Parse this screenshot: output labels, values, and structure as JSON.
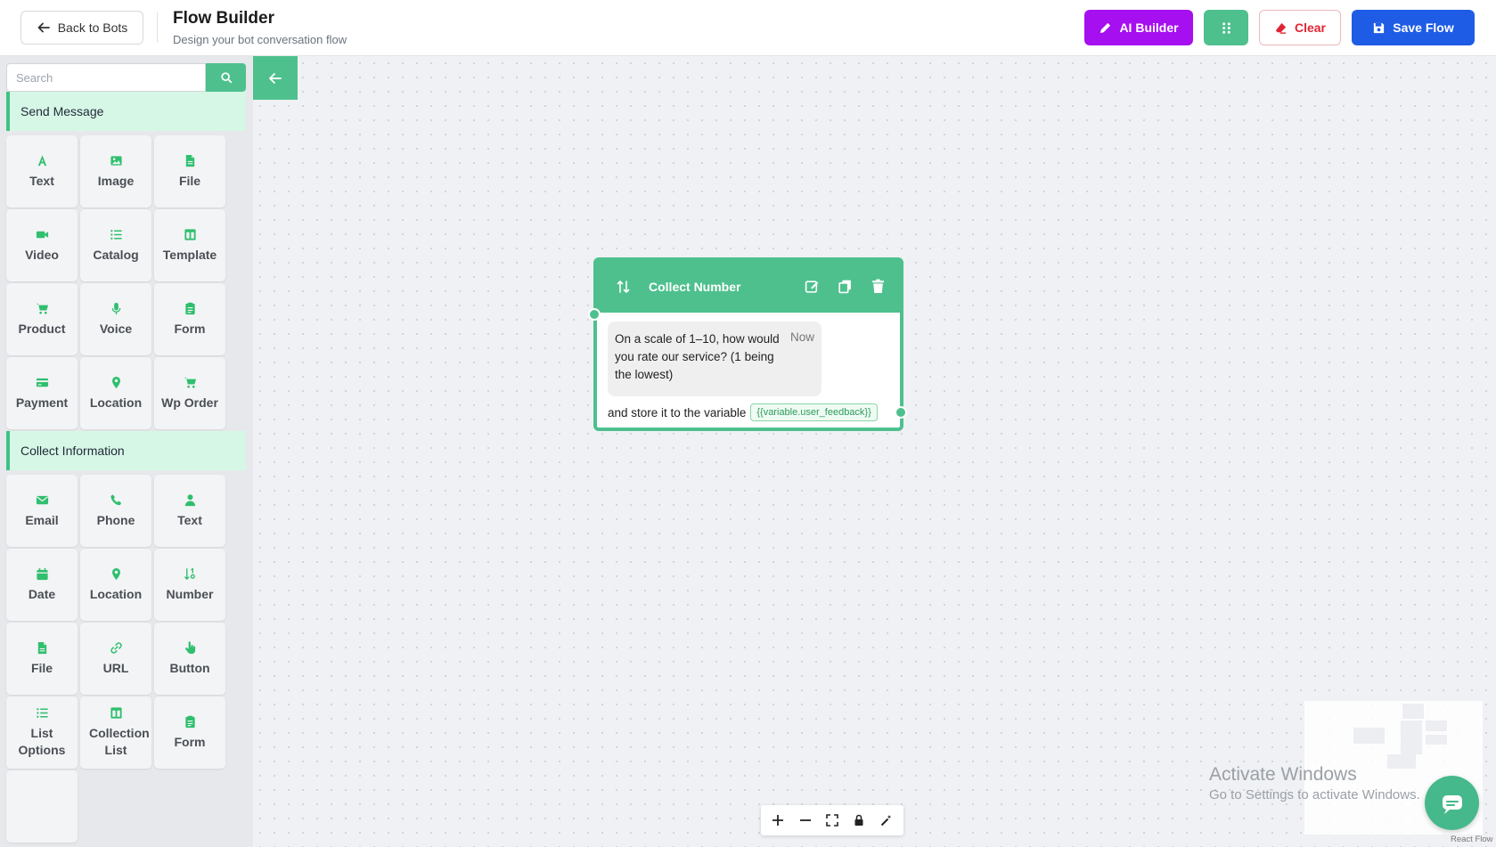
{
  "header": {
    "back_label": "Back to Bots",
    "title": "Flow Builder",
    "subtitle": "Design your bot conversation flow",
    "ai_builder_label": "AI Builder",
    "clear_label": "Clear",
    "save_label": "Save Flow"
  },
  "sidebar": {
    "search_placeholder": "Search",
    "sections": [
      {
        "title": "Send Message",
        "items": [
          {
            "label": "Text",
            "icon": "font-icon"
          },
          {
            "label": "Image",
            "icon": "image-icon"
          },
          {
            "label": "File",
            "icon": "file-icon"
          },
          {
            "label": "Video",
            "icon": "video-icon"
          },
          {
            "label": "Catalog",
            "icon": "list-icon"
          },
          {
            "label": "Template",
            "icon": "template-icon"
          },
          {
            "label": "Product",
            "icon": "cart-icon"
          },
          {
            "label": "Voice",
            "icon": "microphone-icon"
          },
          {
            "label": "Form",
            "icon": "form-icon"
          },
          {
            "label": "Payment",
            "icon": "credit-card-icon"
          },
          {
            "label": "Location",
            "icon": "location-pin-icon"
          },
          {
            "label": "Wp Order",
            "icon": "cart-icon"
          }
        ]
      },
      {
        "title": "Collect Information",
        "items": [
          {
            "label": "Email",
            "icon": "envelope-icon"
          },
          {
            "label": "Phone",
            "icon": "phone-icon"
          },
          {
            "label": "Text",
            "icon": "user-icon"
          },
          {
            "label": "Date",
            "icon": "calendar-icon"
          },
          {
            "label": "Location",
            "icon": "location-pin-icon"
          },
          {
            "label": "Number",
            "icon": "sort-numeric-icon"
          },
          {
            "label": "File",
            "icon": "file-icon"
          },
          {
            "label": "URL",
            "icon": "link-icon"
          },
          {
            "label": "Button",
            "icon": "pointer-hand-icon"
          },
          {
            "label": "List Options",
            "icon": "list-icon"
          },
          {
            "label": "Collection List",
            "icon": "template-icon"
          },
          {
            "label": "Form",
            "icon": "form-icon"
          }
        ]
      }
    ]
  },
  "node": {
    "title": "Collect Number",
    "message": "On a scale of 1–10, how would you rate our service? (1 being the lowest)",
    "time": "Now",
    "store_label": "and store it to the variable",
    "variable": "{{variable.user_feedback}}"
  },
  "watermark": {
    "title": "Activate Windows",
    "subtitle": "Go to Settings to activate Windows."
  },
  "attribution": "React Flow",
  "colors": {
    "accent_green": "#4ec08e",
    "ai_purple": "#a60ff0",
    "save_blue": "#1f5ce6",
    "clear_red": "#e02432"
  }
}
